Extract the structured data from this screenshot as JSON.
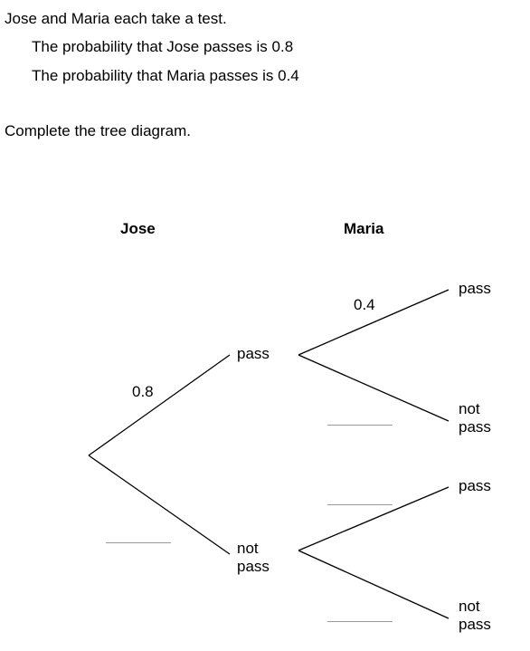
{
  "question": {
    "intro": "Jose and Maria each take a test.",
    "fact_jose": "The probability that Jose passes is 0.8",
    "fact_maria": "The probability that Maria passes is 0.4",
    "instruction": "Complete the tree diagram."
  },
  "tree": {
    "header_jose": "Jose",
    "header_maria": "Maria",
    "jose_pass_prob": "0.8",
    "maria_pass_prob_given_jose_pass": "0.4",
    "outcome_pass": "pass",
    "outcome_not": "not",
    "outcome_not_pass": "pass"
  }
}
